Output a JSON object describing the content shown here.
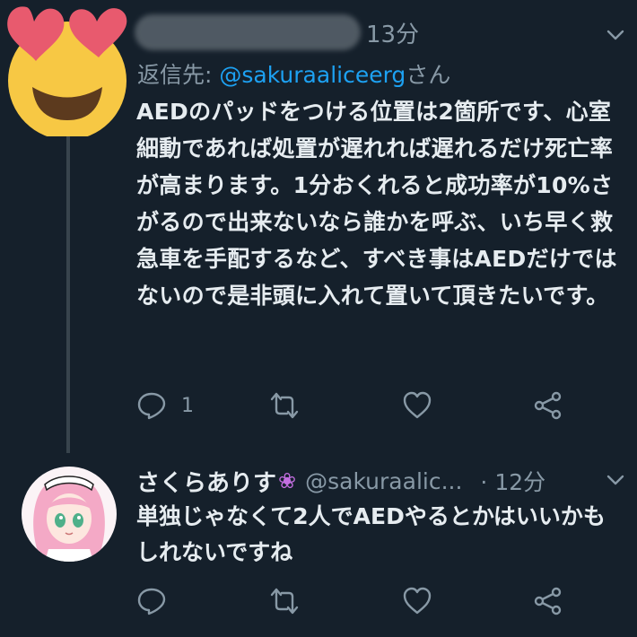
{
  "tweet1": {
    "time": "13分",
    "reply_prefix": "返信先: ",
    "reply_handle": "@sakuraaliceerg",
    "reply_suffix": "さん",
    "body": "AEDのパッドをつける位置は2箇所です、心室細動であれば処置が遅れれば遅れるだけ死亡率が高まります。1分おくれると成功率が10%さがるので出来ないなら誰かを呼ぶ、いち早く救急車を手配するなど、すべき事はAEDだけではないので是非頭に入れて置いて頂きたいです。",
    "reply_count": "1",
    "avatar_emoji": "heart-eyes-emoji"
  },
  "tweet2": {
    "name": "さくらありす",
    "name_emoji": "❀",
    "handle": "@sakuraalic...",
    "time": "· 12分",
    "body": "単独じゃなくて2人でAEDやるとかはいいかもしれないですね"
  },
  "colors": {
    "background": "#15202b",
    "text": "#e6ecf0",
    "secondary": "#8899a6",
    "link": "#1da1f2",
    "thread_line": "#38444d"
  },
  "icons": [
    "reply-icon",
    "retweet-icon",
    "like-icon",
    "share-icon",
    "chevron-down-icon"
  ]
}
